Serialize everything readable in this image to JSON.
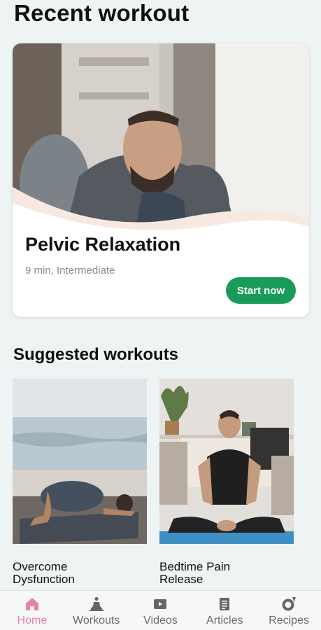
{
  "header": {
    "title": "Recent workout"
  },
  "recent_workout": {
    "title": "Pelvic Relaxation",
    "meta": "9 min, Intermediate",
    "cta_label": "Start now"
  },
  "suggested": {
    "title": "Suggested workouts",
    "items": [
      {
        "title": "Overcome Dysfunction",
        "line1": "Overcome",
        "line2": "Dysfunction"
      },
      {
        "title": "Bedtime Pain Release",
        "line1": "Bedtime Pain",
        "line2": "Release"
      }
    ]
  },
  "bottom_nav": {
    "active": "Home",
    "items": [
      {
        "label": "Home",
        "icon": "home-icon"
      },
      {
        "label": "Workouts",
        "icon": "meditation-person-icon"
      },
      {
        "label": "Videos",
        "icon": "video-play-icon"
      },
      {
        "label": "Articles",
        "icon": "article-book-icon"
      },
      {
        "label": "Recipes",
        "icon": "recipes-icon"
      }
    ]
  },
  "colors": {
    "background": "#eef3f4",
    "accent_green": "#1a9b5a",
    "active_nav": "#e8849a"
  }
}
